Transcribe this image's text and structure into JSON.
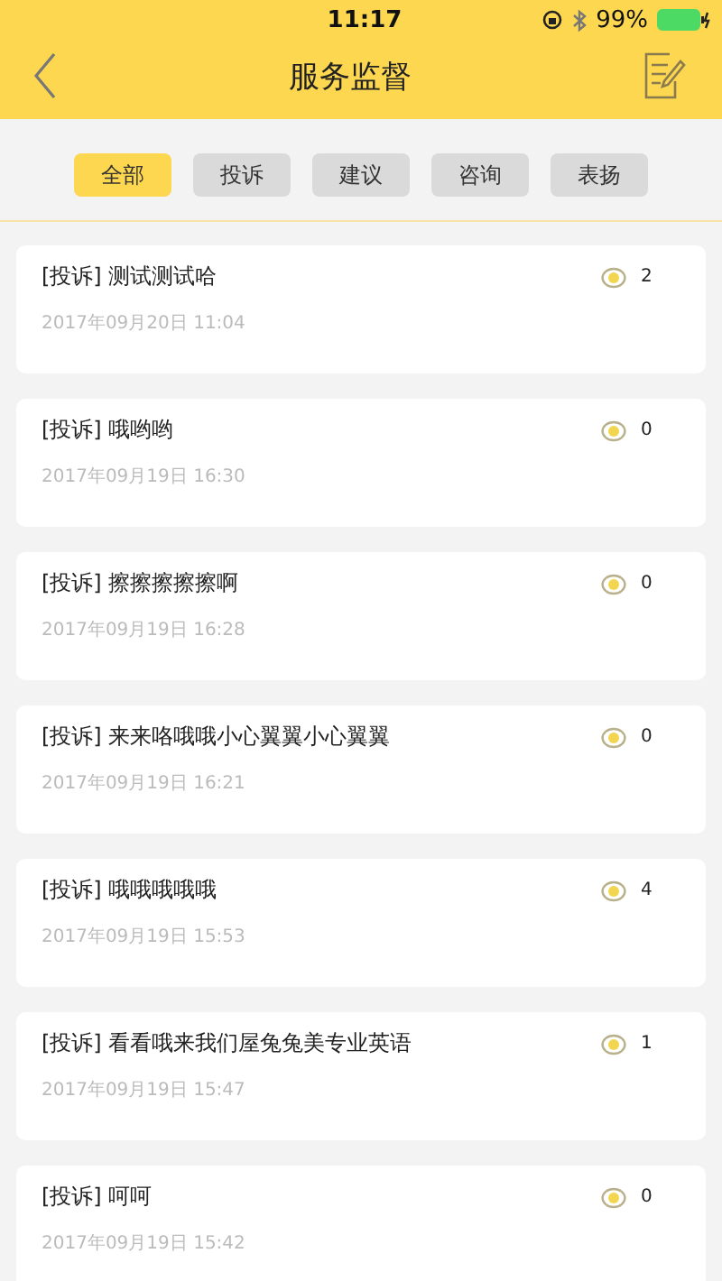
{
  "status_bar": {
    "time": "11:17",
    "battery": "99%"
  },
  "nav": {
    "title": "服务监督"
  },
  "tabs": [
    {
      "label": "全部",
      "selected": true
    },
    {
      "label": "投诉",
      "selected": false
    },
    {
      "label": "建议",
      "selected": false
    },
    {
      "label": "咨询",
      "selected": false
    },
    {
      "label": "表扬",
      "selected": false
    }
  ],
  "items": [
    {
      "title": "[投诉] 测试测试哈",
      "date": "2017年09月20日 11:04",
      "count": "2"
    },
    {
      "title": "[投诉] 哦哟哟",
      "date": "2017年09月19日 16:30",
      "count": "0"
    },
    {
      "title": "[投诉] 擦擦擦擦擦啊",
      "date": "2017年09月19日 16:28",
      "count": "0"
    },
    {
      "title": "[投诉] 来来咯哦哦小心翼翼小心翼翼",
      "date": "2017年09月19日 16:21",
      "count": "0"
    },
    {
      "title": "[投诉] 哦哦哦哦哦",
      "date": "2017年09月19日 15:53",
      "count": "4"
    },
    {
      "title": "[投诉] 看看哦来我们屋兔兔美专业英语",
      "date": "2017年09月19日 15:47",
      "count": "1"
    },
    {
      "title": "[投诉] 呵呵",
      "date": "2017年09月19日 15:42",
      "count": "0"
    }
  ]
}
